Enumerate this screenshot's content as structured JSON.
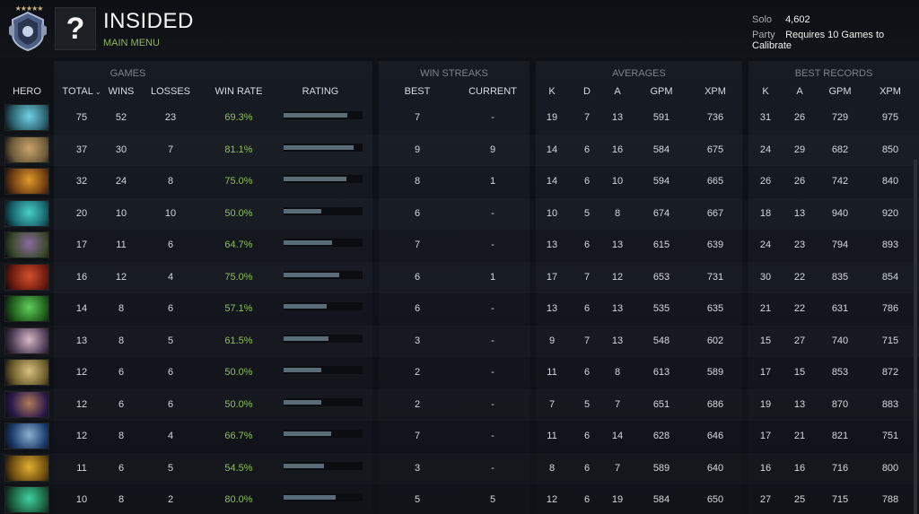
{
  "header": {
    "player_name": "INSIDED",
    "avatar_glyph": "?",
    "main_menu_label": "MAIN MENU",
    "medal_stars": "★★★★★",
    "solo_label": "Solo",
    "solo_value": "4,602",
    "party_label": "Party",
    "party_value": "Requires 10 Games to Calibrate"
  },
  "groups": {
    "games": "GAMES",
    "win_streaks": "WIN STREAKS",
    "averages": "AVERAGES",
    "best_records": "BEST RECORDS"
  },
  "columns": {
    "hero": "HERO",
    "total": "TOTAL",
    "wins": "WINS",
    "losses": "LOSSES",
    "win_rate": "WIN RATE",
    "rating": "RATING",
    "best": "BEST",
    "current": "CURRENT",
    "avg_k": "K",
    "avg_d": "D",
    "avg_a": "A",
    "avg_gpm": "GPM",
    "avg_xpm": "XPM",
    "best_k": "K",
    "best_a": "A",
    "best_gpm": "GPM",
    "best_xpm": "XPM"
  },
  "colors": {
    "accent_green": "#8fbf5a",
    "rating_bar": "#5a6c78"
  },
  "rows": [
    {
      "total": "75",
      "wins": "52",
      "losses": "23",
      "win_rate": "69.3%",
      "rating": 0.81,
      "best": "7",
      "current": "-",
      "k": "19",
      "d": "7",
      "a": "13",
      "gpm": "591",
      "xpm": "736",
      "bk": "31",
      "ba": "26",
      "bgpm": "729",
      "bxpm": "975",
      "portrait": [
        "#2a5d6a",
        "#6fd3e6"
      ]
    },
    {
      "total": "37",
      "wins": "30",
      "losses": "7",
      "win_rate": "81.1%",
      "rating": 0.89,
      "best": "9",
      "current": "9",
      "k": "14",
      "d": "6",
      "a": "16",
      "gpm": "584",
      "xpm": "675",
      "bk": "24",
      "ba": "29",
      "bgpm": "682",
      "bxpm": "850",
      "portrait": [
        "#6b5a3a",
        "#c9a36a"
      ]
    },
    {
      "total": "32",
      "wins": "24",
      "losses": "8",
      "win_rate": "75.0%",
      "rating": 0.79,
      "best": "8",
      "current": "1",
      "k": "14",
      "d": "6",
      "a": "10",
      "gpm": "594",
      "xpm": "665",
      "bk": "26",
      "ba": "26",
      "bgpm": "742",
      "bxpm": "840",
      "portrait": [
        "#6a3a12",
        "#e09a2a"
      ]
    },
    {
      "total": "20",
      "wins": "10",
      "losses": "10",
      "win_rate": "50.0%",
      "rating": 0.48,
      "best": "6",
      "current": "-",
      "k": "10",
      "d": "5",
      "a": "8",
      "gpm": "674",
      "xpm": "667",
      "bk": "18",
      "ba": "13",
      "bgpm": "940",
      "bxpm": "920",
      "portrait": [
        "#17606a",
        "#4ad0c8"
      ]
    },
    {
      "total": "17",
      "wins": "11",
      "losses": "6",
      "win_rate": "64.7%",
      "rating": 0.61,
      "best": "7",
      "current": "-",
      "k": "13",
      "d": "6",
      "a": "13",
      "gpm": "615",
      "xpm": "639",
      "bk": "24",
      "ba": "23",
      "bgpm": "794",
      "bxpm": "893",
      "portrait": [
        "#3a4a2a",
        "#8a6aa0"
      ]
    },
    {
      "total": "16",
      "wins": "12",
      "losses": "4",
      "win_rate": "75.0%",
      "rating": 0.7,
      "best": "6",
      "current": "1",
      "k": "17",
      "d": "7",
      "a": "12",
      "gpm": "653",
      "xpm": "731",
      "bk": "30",
      "ba": "22",
      "bgpm": "835",
      "bxpm": "854",
      "portrait": [
        "#6a1a10",
        "#d2502a"
      ]
    },
    {
      "total": "14",
      "wins": "8",
      "losses": "6",
      "win_rate": "57.1%",
      "rating": 0.54,
      "best": "6",
      "current": "-",
      "k": "13",
      "d": "6",
      "a": "13",
      "gpm": "535",
      "xpm": "635",
      "bk": "21",
      "ba": "22",
      "bgpm": "631",
      "bxpm": "786",
      "portrait": [
        "#1e5a1a",
        "#5ed05a"
      ]
    },
    {
      "total": "13",
      "wins": "8",
      "losses": "5",
      "win_rate": "61.5%",
      "rating": 0.57,
      "best": "3",
      "current": "-",
      "k": "9",
      "d": "7",
      "a": "13",
      "gpm": "548",
      "xpm": "602",
      "bk": "15",
      "ba": "27",
      "bgpm": "740",
      "bxpm": "715",
      "portrait": [
        "#4a3a52",
        "#d8b8c8"
      ]
    },
    {
      "total": "12",
      "wins": "6",
      "losses": "6",
      "win_rate": "50.0%",
      "rating": 0.48,
      "best": "2",
      "current": "-",
      "k": "11",
      "d": "6",
      "a": "8",
      "gpm": "613",
      "xpm": "589",
      "bk": "17",
      "ba": "15",
      "bgpm": "853",
      "bxpm": "872",
      "portrait": [
        "#6a5a2a",
        "#d8c080"
      ]
    },
    {
      "total": "12",
      "wins": "6",
      "losses": "6",
      "win_rate": "50.0%",
      "rating": 0.48,
      "best": "2",
      "current": "-",
      "k": "7",
      "d": "5",
      "a": "7",
      "gpm": "651",
      "xpm": "686",
      "bk": "19",
      "ba": "13",
      "bgpm": "870",
      "bxpm": "883",
      "portrait": [
        "#2a1a4a",
        "#b07a5a"
      ]
    },
    {
      "total": "12",
      "wins": "8",
      "losses": "4",
      "win_rate": "66.7%",
      "rating": 0.6,
      "best": "7",
      "current": "-",
      "k": "11",
      "d": "6",
      "a": "14",
      "gpm": "628",
      "xpm": "646",
      "bk": "17",
      "ba": "21",
      "bgpm": "821",
      "bxpm": "751",
      "portrait": [
        "#1a3a6a",
        "#8ab0d0"
      ]
    },
    {
      "total": "11",
      "wins": "6",
      "losses": "5",
      "win_rate": "54.5%",
      "rating": 0.51,
      "best": "3",
      "current": "-",
      "k": "8",
      "d": "6",
      "a": "7",
      "gpm": "589",
      "xpm": "640",
      "bk": "16",
      "ba": "16",
      "bgpm": "716",
      "bxpm": "800",
      "portrait": [
        "#6a4a10",
        "#e0b030"
      ]
    },
    {
      "total": "10",
      "wins": "8",
      "losses": "2",
      "win_rate": "80.0%",
      "rating": 0.66,
      "best": "5",
      "current": "5",
      "k": "12",
      "d": "6",
      "a": "19",
      "gpm": "584",
      "xpm": "650",
      "bk": "27",
      "ba": "25",
      "bgpm": "715",
      "bxpm": "788",
      "portrait": [
        "#1a5a3a",
        "#40d0a0"
      ]
    }
  ]
}
